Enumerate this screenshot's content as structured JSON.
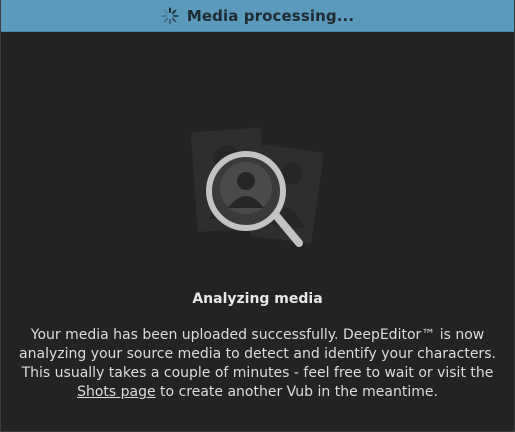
{
  "header": {
    "title": "Media processing...",
    "icon": "spinner-icon",
    "background_color": "#5b9aba"
  },
  "illustration": {
    "icon": "magnifier-over-portraits-icon"
  },
  "status": {
    "title": "Analyzing media"
  },
  "description": {
    "line1": "Your media has been uploaded successfully. DeepEditor™ is now",
    "line2": "analyzing your source media to detect and identify your characters.",
    "line3": "This usually takes a couple of minutes - feel free to wait or visit the",
    "link_text": "Shots page",
    "line4_suffix": " to create another Vub in the meantime."
  }
}
